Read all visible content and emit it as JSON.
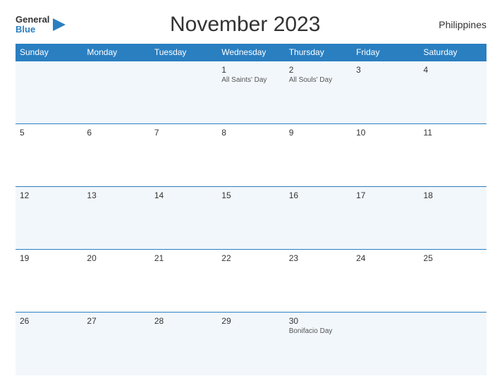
{
  "header": {
    "logo_general": "General",
    "logo_blue": "Blue",
    "title": "November 2023",
    "country": "Philippines"
  },
  "columns": [
    "Sunday",
    "Monday",
    "Tuesday",
    "Wednesday",
    "Thursday",
    "Friday",
    "Saturday"
  ],
  "weeks": [
    [
      {
        "day": "",
        "holiday": ""
      },
      {
        "day": "",
        "holiday": ""
      },
      {
        "day": "",
        "holiday": ""
      },
      {
        "day": "1",
        "holiday": "All Saints' Day"
      },
      {
        "day": "2",
        "holiday": "All Souls' Day"
      },
      {
        "day": "3",
        "holiday": ""
      },
      {
        "day": "4",
        "holiday": ""
      }
    ],
    [
      {
        "day": "5",
        "holiday": ""
      },
      {
        "day": "6",
        "holiday": ""
      },
      {
        "day": "7",
        "holiday": ""
      },
      {
        "day": "8",
        "holiday": ""
      },
      {
        "day": "9",
        "holiday": ""
      },
      {
        "day": "10",
        "holiday": ""
      },
      {
        "day": "11",
        "holiday": ""
      }
    ],
    [
      {
        "day": "12",
        "holiday": ""
      },
      {
        "day": "13",
        "holiday": ""
      },
      {
        "day": "14",
        "holiday": ""
      },
      {
        "day": "15",
        "holiday": ""
      },
      {
        "day": "16",
        "holiday": ""
      },
      {
        "day": "17",
        "holiday": ""
      },
      {
        "day": "18",
        "holiday": ""
      }
    ],
    [
      {
        "day": "19",
        "holiday": ""
      },
      {
        "day": "20",
        "holiday": ""
      },
      {
        "day": "21",
        "holiday": ""
      },
      {
        "day": "22",
        "holiday": ""
      },
      {
        "day": "23",
        "holiday": ""
      },
      {
        "day": "24",
        "holiday": ""
      },
      {
        "day": "25",
        "holiday": ""
      }
    ],
    [
      {
        "day": "26",
        "holiday": ""
      },
      {
        "day": "27",
        "holiday": ""
      },
      {
        "day": "28",
        "holiday": ""
      },
      {
        "day": "29",
        "holiday": ""
      },
      {
        "day": "30",
        "holiday": "Bonifacio Day"
      },
      {
        "day": "",
        "holiday": ""
      },
      {
        "day": "",
        "holiday": ""
      }
    ]
  ]
}
